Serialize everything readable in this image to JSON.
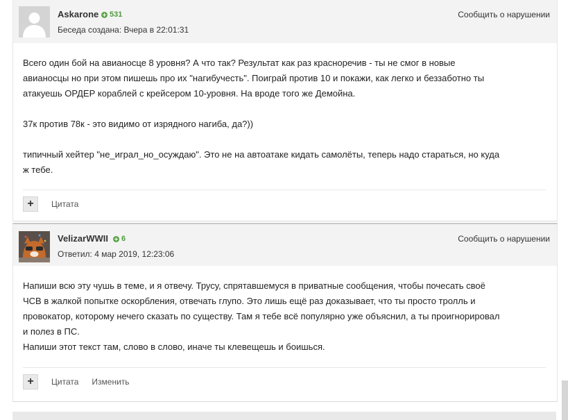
{
  "posts": [
    {
      "username": "Askarone",
      "reputation": "531",
      "meta": "Беседа создана: Вчера в 22:01:31",
      "report_label": "Сообщить о нарушении",
      "paragraphs": [
        "Всего один бой на авианосце 8 уровня? А что так? Результат как раз красноречив - ты не смог в новые",
        "авианосцы но при этом пишешь про их \"нагибучесть\". Поиграй против 10 и покажи, как легко и беззаботно ты",
        "атакуешь ОРДЕР кораблей с крейсером 10-уровня. На вроде того же Демойна.",
        "37к против 78к - это видимо от изрядного нагиба, да?))",
        "типичный хейтер \"не_играл_но_осуждаю\".  Это не на автоатаке кидать самолёты, теперь надо стараться, но куда",
        "ж тебе."
      ],
      "actions": {
        "plus": "+",
        "quote": "Цитата"
      }
    },
    {
      "username": "VelizarWWII",
      "reputation": "6",
      "meta": "Ответил: 4 мар 2019, 12:23:06",
      "report_label": "Сообщить о нарушении",
      "paragraphs": [
        "Напиши всю эту чушь в теме, и я отвечу. Трусу, спрятавшемуся в приватные сообщения, чтобы почесать своё",
        "ЧСВ в жалкой попытке оскорбления, отвечать глупо. Это лишь ещё раз доказывает, что ты просто тролль и",
        "провокатор, которому нечего сказать по существу. Там я тебе всё популярно уже объяснил, а ты проигнорировал",
        "и полез в ПС.",
        "Напиши этот текст там, слово в слово, иначе ты клевещешь и боишься."
      ],
      "actions": {
        "plus": "+",
        "quote": "Цитата",
        "edit": "Изменить"
      }
    }
  ]
}
